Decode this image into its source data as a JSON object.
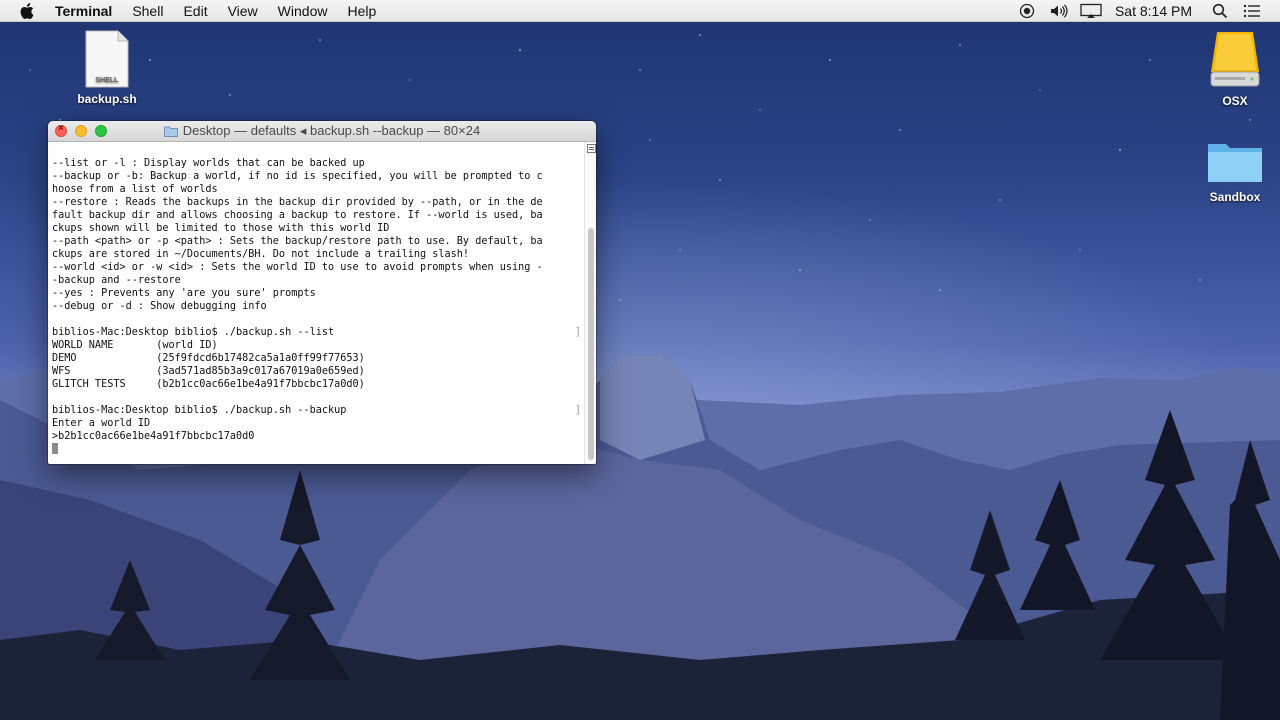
{
  "menubar": {
    "app_name": "Terminal",
    "menus": [
      "Shell",
      "Edit",
      "View",
      "Window",
      "Help"
    ],
    "clock": "Sat 8:14 PM",
    "icons": [
      "apple-icon",
      "record-icon",
      "volume-icon",
      "display-icon",
      "spotlight-icon",
      "notification-center-icon"
    ]
  },
  "desktop": {
    "icons": [
      {
        "label": "backup.sh",
        "badge": "SHELL",
        "icon": "shell-script-file-icon"
      },
      {
        "label": "OSX",
        "icon": "hard-drive-icon"
      },
      {
        "label": "Sandbox",
        "icon": "folder-icon"
      }
    ]
  },
  "terminal": {
    "title": "Desktop — defaults ◂ backup.sh --backup — 80×24",
    "lines": [
      {
        "text": "--list or -l : Display worlds that can be backed up",
        "mark": ""
      },
      {
        "text": "--backup or -b: Backup a world, if no id is specified, you will be prompted to c",
        "mark": ""
      },
      {
        "text": "hoose from a list of worlds",
        "mark": ""
      },
      {
        "text": "--restore : Reads the backups in the backup dir provided by --path, or in the de",
        "mark": ""
      },
      {
        "text": "fault backup dir and allows choosing a backup to restore. If --world is used, ba",
        "mark": ""
      },
      {
        "text": "ckups shown will be limited to those with this world ID",
        "mark": ""
      },
      {
        "text": "--path <path> or -p <path> : Sets the backup/restore path to use. By default, ba",
        "mark": ""
      },
      {
        "text": "ckups are stored in ~/Documents/BH. Do not include a trailing slash!",
        "mark": ""
      },
      {
        "text": "--world <id> or -w <id> : Sets the world ID to use to avoid prompts when using -",
        "mark": ""
      },
      {
        "text": "-backup and --restore",
        "mark": ""
      },
      {
        "text": "--yes : Prevents any 'are you sure' prompts",
        "mark": ""
      },
      {
        "text": "--debug or -d : Show debugging info",
        "mark": ""
      },
      {
        "text": "",
        "mark": ""
      },
      {
        "text": "biblios-Mac:Desktop biblio$ ./backup.sh --list",
        "mark": "]"
      },
      {
        "text": "WORLD NAME       (world ID)",
        "mark": ""
      },
      {
        "text": "DEMO             (25f9fdcd6b17482ca5a1a0ff99f77653)",
        "mark": ""
      },
      {
        "text": "WFS              (3ad571ad85b3a9c017a67019a0e659ed)",
        "mark": ""
      },
      {
        "text": "GLITCH TESTS     (b2b1cc0ac66e1be4a91f7bbcbc17a0d0)",
        "mark": ""
      },
      {
        "text": "",
        "mark": ""
      },
      {
        "text": "biblios-Mac:Desktop biblio$ ./backup.sh --backup",
        "mark": "]"
      },
      {
        "text": "Enter a world ID",
        "mark": ""
      },
      {
        "text": ">b2b1cc0ac66e1be4a91f7bbcbc17a0d0",
        "mark": ""
      }
    ]
  }
}
